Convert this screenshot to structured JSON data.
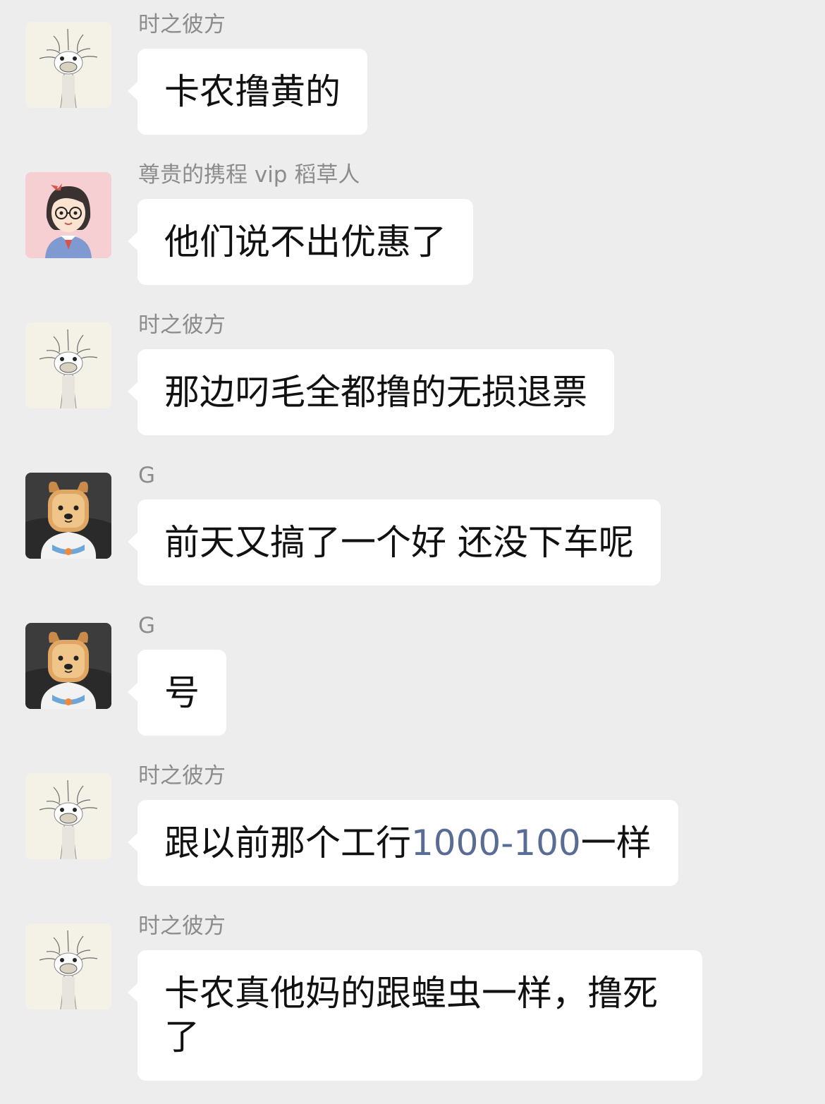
{
  "messages": [
    {
      "sender": "时之彼方",
      "avatar": "ostrich-avatar",
      "text": "卡农撸黄的"
    },
    {
      "sender": "尊贵的携程 vip 稻草人",
      "avatar": "girl-avatar",
      "text": "他们说不出优惠了"
    },
    {
      "sender": "时之彼方",
      "avatar": "ostrich-avatar",
      "text": "那边叼毛全都撸的无损退票"
    },
    {
      "sender": "G",
      "avatar": "dog-avatar",
      "text": "前天又搞了一个好 还没下车呢"
    },
    {
      "sender": "G",
      "avatar": "dog-avatar",
      "text": "号"
    },
    {
      "sender": "时之彼方",
      "avatar": "ostrich-avatar",
      "text_before": "跟以前那个工行",
      "text_link": "1000-100",
      "text_after": "一样"
    },
    {
      "sender": "时之彼方",
      "avatar": "ostrich-avatar",
      "text": "卡农真他妈的跟蝗虫一样，撸死了"
    }
  ],
  "colors": {
    "background": "#ededed",
    "bubble": "#ffffff",
    "sender_name": "#8c8c8c",
    "link": "#586c94"
  }
}
